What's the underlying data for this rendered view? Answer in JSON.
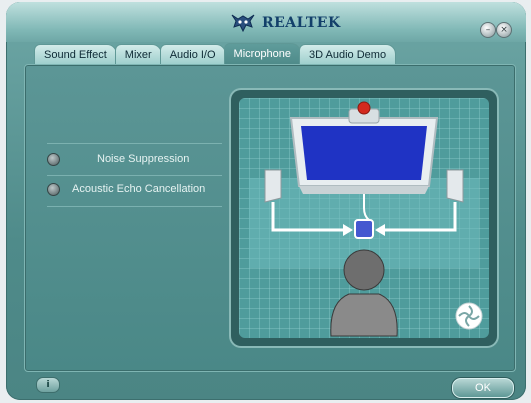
{
  "app": {
    "brand": "REALTEK"
  },
  "tabs": [
    {
      "label": "Sound Effect"
    },
    {
      "label": "Mixer"
    },
    {
      "label": "Audio I/O"
    },
    {
      "label": "Microphone",
      "active": true
    },
    {
      "label": "3D Audio Demo"
    }
  ],
  "options": [
    {
      "label": "Noise Suppression",
      "checked": false
    },
    {
      "label": "Acoustic Echo Cancellation",
      "checked": false
    }
  ],
  "buttons": {
    "ok_label": "OK",
    "info_label": "i"
  },
  "colors": {
    "window": "#4f8b8a",
    "accent": "#2d42c8",
    "text": "#e6f3f2"
  }
}
